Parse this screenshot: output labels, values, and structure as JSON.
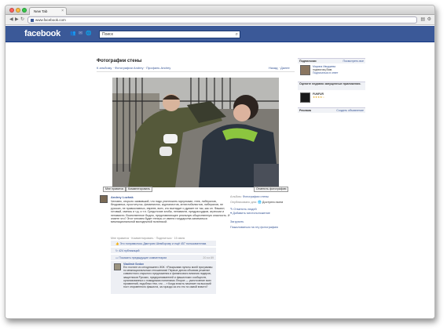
{
  "browser": {
    "tab_title": "New Tab",
    "tab_close": "×",
    "url": "www.facebook.com",
    "back_icon": "◀",
    "forward_icon": "▶",
    "reload_icon": "↻"
  },
  "fb": {
    "logo": "facebook",
    "search_placeholder": "Поиск"
  },
  "page": {
    "title": "Фотографии стены",
    "breadcrumbs": "К альбому · Фотографии Andrey · Профиль Andrey",
    "pager": "Назад · Далее"
  },
  "buttons": {
    "like": "Мне нравится",
    "comment": "Комментировать",
    "tag": "Отметить фотографию"
  },
  "post": {
    "author": "Andrey Lozhak",
    "description": "Человек, открыто заявивший, что надо уничтожить мусульман, геев, либералов, бездомных, проституток, феминисток, журналистов, антиглобалистов, либералов, не русских, не православных, евреев, всех, кто выглядит и думает не так, как он. Фашист, готовый, смеясь и т.д. и т.п. Средоточие злобы, ненависти, предрассудков, агрессии и ненависти. Воинственное быдло, представляющее реальную общественную опасность. И знаете что? Этот человек будет теперь от имени государства заниматься межнациональной молодежной политикой.",
    "meta_date": "Мне нравится · Комментировать · Поделиться · 15 июня"
  },
  "side_info": {
    "album_label": "Альбом:",
    "album_value": "Фотографии стены",
    "published": "Опубликовано для:",
    "published_value": "Доступно всем",
    "tag_people": "Отметить людей",
    "add_location": "Добавить местоположение",
    "download": "Загрузить",
    "report": "Пожаловаться на эту фотографию"
  },
  "feedback": {
    "likes": "Это понравилось Дмитрию Шемборову и ещё 457 пользователям.",
    "shares": "424 публикаций",
    "prev_comments": "Показать предыдущие комментарии",
    "prev_count": "20 из 89",
    "comment_author": "Vladimir Sedov",
    "comment_text": "Его постинг из сегодняшнего ЖЖ. «Раскрываю пункты моей программы по межнациональным отношениям! Первые делом объявим решение совместного открытого предложения и финансового влияния лидеров, защитников Русских, предпринимателей и фашистских сообществ, организованных с номадными понятиями. Второе — ужесточение всех проявлений, подобных тем, что ... » Когда власть начинает на высокий пост откровенного фашиста, за гораздо за кто это та самой власти?"
  },
  "rail": {
    "h1": "Подписчики",
    "h1_link": "Посмотреть все",
    "sub_name": "Марина Иводжева",
    "sub_text": "подписчиц Вам.",
    "sub_link": "Подписаться в ответ",
    "h2": "Оцените недавно запущенные приложения.",
    "app_name": "FUNFUR",
    "app_rating": "★★★★☆",
    "h3": "Реклама",
    "h3_link": "Создать объявление"
  },
  "colors": {
    "brand": "#3b5998",
    "link": "#3b5998"
  }
}
